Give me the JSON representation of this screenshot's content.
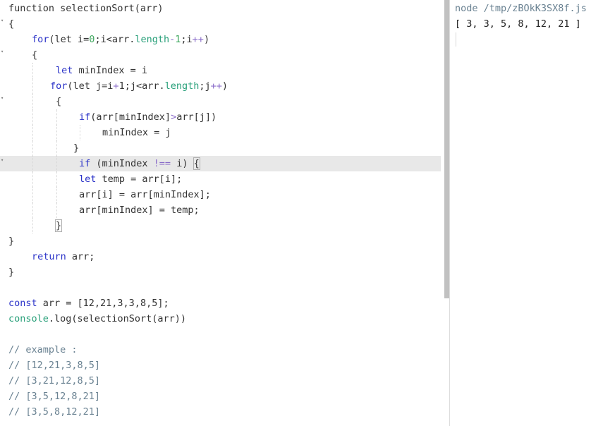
{
  "editor": {
    "lines": [
      [
        {
          "t": "function selectionSort(arr)"
        }
      ],
      [
        {
          "t": "{"
        }
      ],
      [
        {
          "t": "for",
          "c": "kw"
        },
        {
          "t": "(let i="
        },
        {
          "t": "0",
          "c": "num"
        },
        {
          "t": ";i<arr."
        },
        {
          "t": "length",
          "c": "prop"
        },
        {
          "t": "-",
          "c": "op"
        },
        {
          "t": "1",
          "c": "num"
        },
        {
          "t": ";i"
        },
        {
          "t": "++",
          "c": "op"
        },
        {
          "t": ")"
        }
      ],
      [
        {
          "t": "{"
        }
      ],
      [
        {
          "t": "let",
          "c": "kw"
        },
        {
          "t": " minIndex = i"
        }
      ],
      [
        {
          "t": "for",
          "c": "kw"
        },
        {
          "t": "(let j=i"
        },
        {
          "t": "+",
          "c": "op"
        },
        {
          "t": "1;j<arr."
        },
        {
          "t": "length",
          "c": "prop"
        },
        {
          "t": ";j"
        },
        {
          "t": "++",
          "c": "op"
        },
        {
          "t": ")"
        }
      ],
      [
        {
          "t": "{"
        }
      ],
      [
        {
          "t": "if",
          "c": "kw"
        },
        {
          "t": "(arr[minIndex]"
        },
        {
          "t": ">",
          "c": "op"
        },
        {
          "t": "arr[j])"
        }
      ],
      [
        {
          "t": "minIndex = j"
        }
      ],
      [
        {
          "t": "}"
        }
      ],
      [
        {
          "t": "if",
          "c": "kw"
        },
        {
          "t": " (minIndex "
        },
        {
          "t": "!==",
          "c": "op"
        },
        {
          "t": " i) "
        },
        {
          "t": "{",
          "c": "match"
        }
      ],
      [
        {
          "t": "let",
          "c": "kw"
        },
        {
          "t": " temp = arr[i];"
        }
      ],
      [
        {
          "t": "arr[i] = arr[minIndex];"
        }
      ],
      [
        {
          "t": "arr[minIndex] = temp;"
        }
      ],
      [
        {
          "t": "}",
          "c": "match"
        }
      ],
      [
        {
          "t": "}"
        }
      ],
      [
        {
          "t": "return",
          "c": "kw"
        },
        {
          "t": " arr;"
        }
      ],
      [
        {
          "t": "}"
        }
      ],
      [],
      [
        {
          "t": "const",
          "c": "kw"
        },
        {
          "t": " arr = [12,21,3,3,8,5];"
        }
      ],
      [
        {
          "t": "console",
          "c": "prop"
        },
        {
          "t": ".log(selectionSort(arr))"
        }
      ],
      [],
      [
        {
          "t": "// example :",
          "c": "cmt"
        }
      ],
      [
        {
          "t": "// [12,21,3,8,5]",
          "c": "cmt"
        }
      ],
      [
        {
          "t": "// [3,21,12,8,5]",
          "c": "cmt"
        }
      ],
      [
        {
          "t": "// [3,5,12,8,21]",
          "c": "cmt"
        }
      ],
      [
        {
          "t": "// [3,5,8,12,21]",
          "c": "cmt"
        }
      ]
    ]
  },
  "output": {
    "command": "node /tmp/zBOkK3SX8f.js",
    "result": "[ 3, 3, 5, 8, 12, 21 ]"
  }
}
